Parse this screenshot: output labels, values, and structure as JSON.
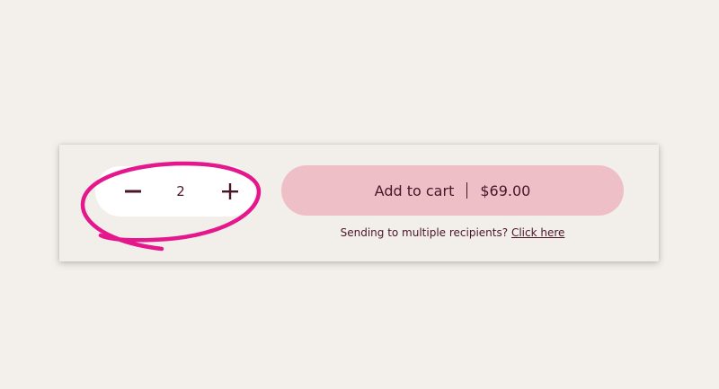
{
  "quantity": {
    "value": "2",
    "decrease_icon": "minus-icon",
    "increase_icon": "plus-icon"
  },
  "add_to_cart": {
    "label": "Add to cart",
    "price": "$69.00"
  },
  "recipients": {
    "prompt": "Sending to multiple recipients?",
    "link_label": "Click here"
  },
  "annotation": {
    "color": "#e5178c",
    "target": "quantity-stepper"
  },
  "colors": {
    "background": "#f3f0ec",
    "panel": "#f2efeb",
    "button": "#efbfc7",
    "text": "#4a1529"
  }
}
